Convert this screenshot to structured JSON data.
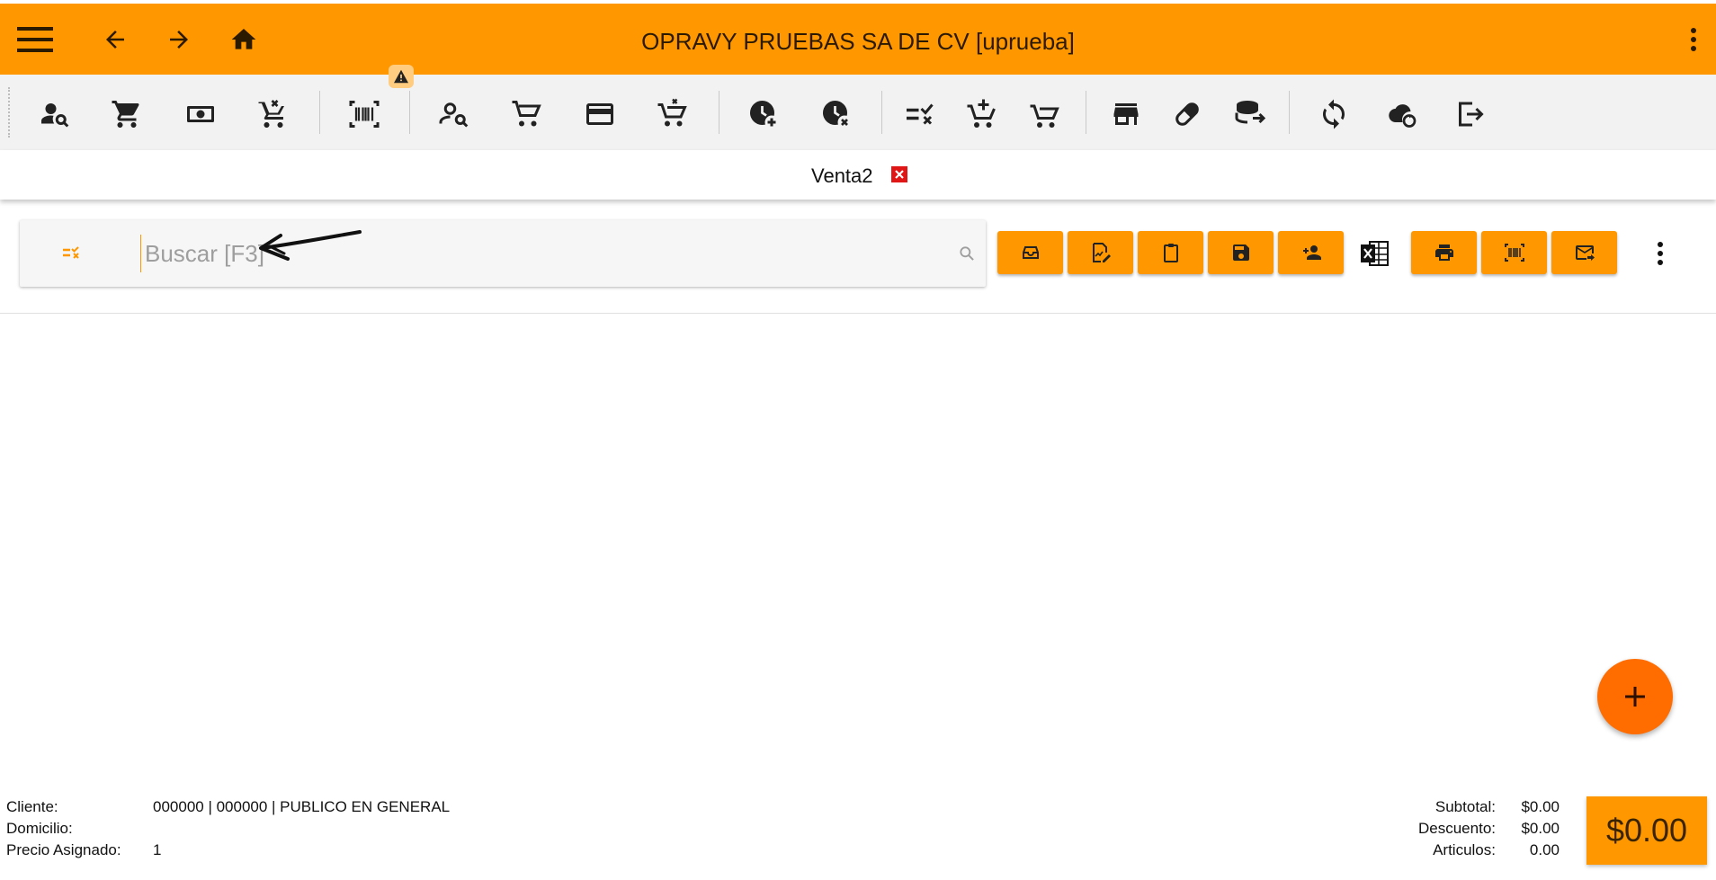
{
  "header": {
    "title": "OPRAVY PRUEBAS SA DE CV [uprueba]",
    "background_color": "#ff9800",
    "icons": [
      "menu-icon",
      "back-arrow-icon",
      "forward-arrow-icon",
      "home-icon",
      "more-vert-icon"
    ]
  },
  "toolbar": {
    "warning_badge": "warning-icon",
    "groups": [
      [
        "customer-search-icon",
        "cart-icon",
        "cash-icon",
        "cart-remove-icon"
      ],
      [
        "barcode-scan-icon"
      ],
      [
        "person-search-icon",
        "cart-outline-icon",
        "credit-card-icon",
        "cart-remove-outline-icon"
      ],
      [
        "clock-add-icon",
        "clock-cancel-icon"
      ],
      [
        "list-check-icon",
        "cart-plus-icon",
        "cart-arrow-icon"
      ],
      [
        "store-icon",
        "pill-icon",
        "database-export-icon"
      ],
      [
        "sync-icon",
        "cloud-sync-icon",
        "logout-icon"
      ]
    ]
  },
  "tabs": [
    {
      "label": "Venta2",
      "close_color": "#e01515"
    }
  ],
  "search": {
    "placeholder": "Buscar [F3]",
    "value": ""
  },
  "actions": {
    "accent_color": "#ff9800",
    "buttons": [
      "drawer-icon",
      "signature-icon",
      "clipboard-icon",
      "save-icon",
      "add-person-icon",
      "excel-icon",
      "print-icon",
      "barcode-icon",
      "mail-send-icon",
      "more-vert-icon"
    ]
  },
  "fab": {
    "icon": "plus-icon",
    "color": "#ff6d00"
  },
  "footer": {
    "cliente_label": "Cliente:",
    "cliente_value": "000000 | 000000 | PUBLICO EN GENERAL",
    "domicilio_label": "Domicilio:",
    "domicilio_value": "",
    "precio_label": "Precio Asignado:",
    "precio_value": "1",
    "subtotal_label": "Subtotal:",
    "subtotal_value": "$0.00",
    "descuento_label": "Descuento:",
    "descuento_value": "$0.00",
    "articulos_label": "Articulos:",
    "articulos_value": "0.00",
    "total": "$0.00"
  }
}
